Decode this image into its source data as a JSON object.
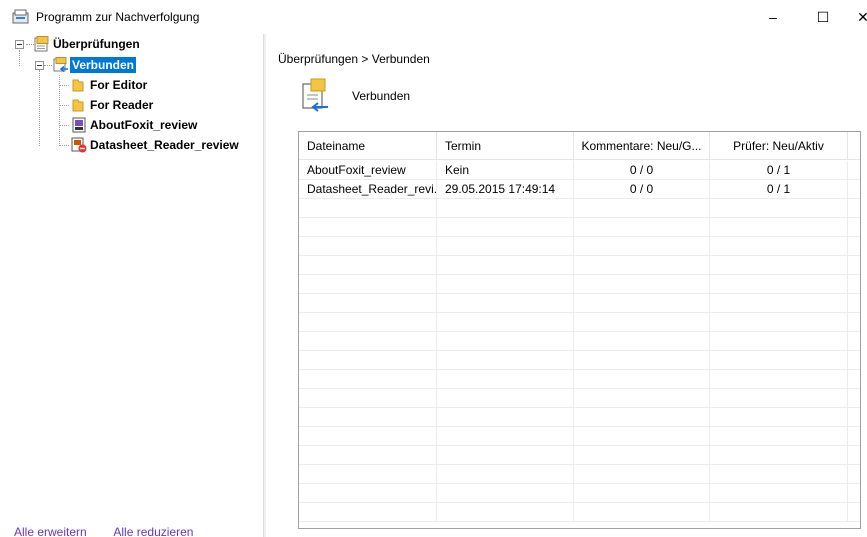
{
  "window": {
    "title": "Programm zur Nachverfolgung",
    "minimize_glyph": "–",
    "maximize_glyph": "☐",
    "close_glyph": "✕"
  },
  "tree": {
    "root_label": "Überprüfungen",
    "items": [
      {
        "label": "Verbunden",
        "icon": "connected-folder-icon",
        "selected": true
      },
      {
        "label": "For Editor",
        "icon": "folder-icon"
      },
      {
        "label": "For Reader",
        "icon": "folder-icon"
      },
      {
        "label": "AboutFoxit_review",
        "icon": "pdf-document-icon"
      },
      {
        "label": "Datasheet_Reader_review",
        "icon": "pdf-document-error-icon"
      }
    ]
  },
  "footer": {
    "expand_all": "Alle erweitern",
    "collapse_all": "Alle reduzieren"
  },
  "main": {
    "breadcrumb": "Überprüfungen > Verbunden",
    "heading": "Verbunden"
  },
  "table": {
    "columns": [
      "Dateiname",
      "Termin",
      "Kommentare: Neu/G...",
      "Prüfer: Neu/Aktiv"
    ],
    "rows": [
      [
        "AboutFoxit_review",
        "Kein",
        "0 / 0",
        "0 / 1"
      ],
      [
        "Datasheet_Reader_revi...",
        "29.05.2015 17:49:14",
        "0 / 0",
        "0 / 1"
      ]
    ]
  },
  "colors": {
    "selection": "#0078d7",
    "link": "#6a34c9",
    "folder": "#f4c542"
  }
}
